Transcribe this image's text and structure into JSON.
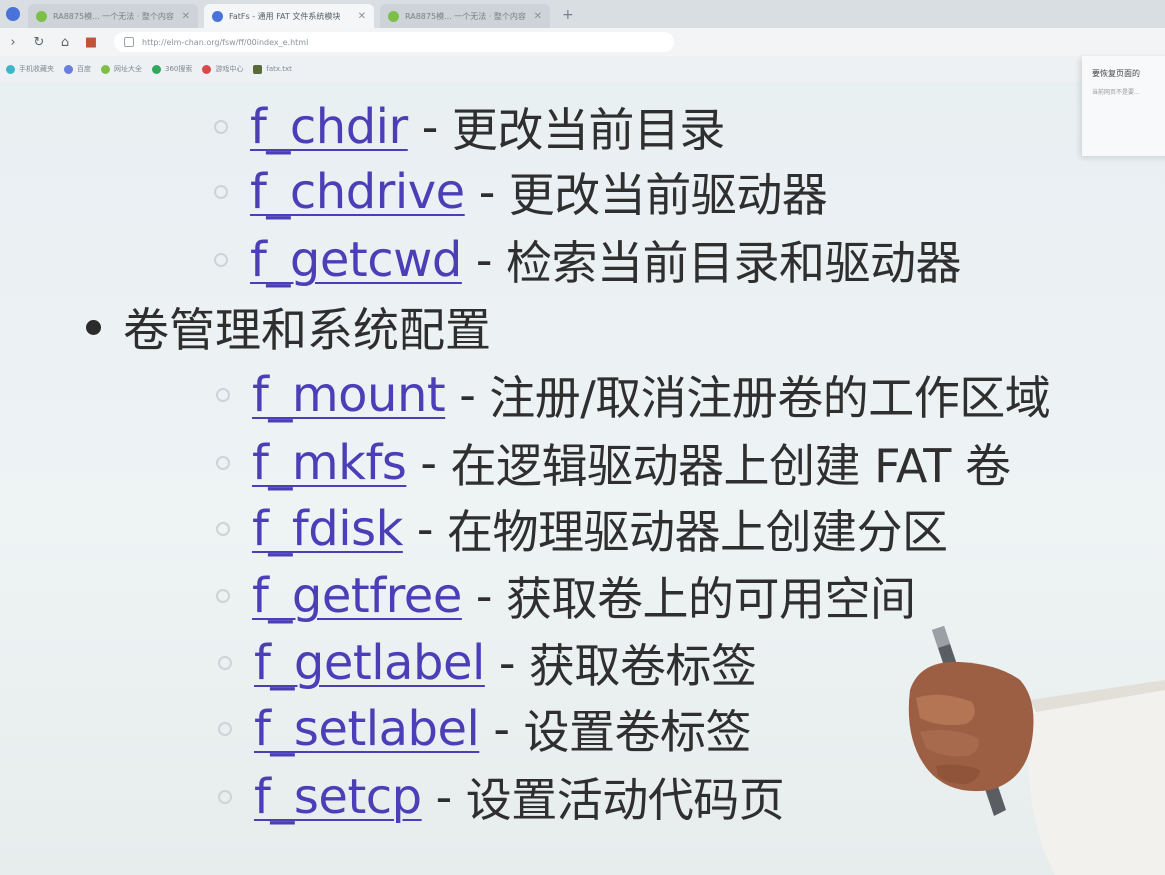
{
  "browser": {
    "tabs": [
      {
        "title": "RA8875模... 一个无法 · 整个内容",
        "active": false,
        "favicon_color": "#7cc04a"
      },
      {
        "title": "FatFs - 通用 FAT 文件系统模块",
        "active": true,
        "favicon_color": "#4a72d8"
      },
      {
        "title": "RA8875模... 一个无法 · 整个内容",
        "active": false,
        "favicon_color": "#7cc04a"
      }
    ],
    "address": "http://elm-chan.org/fsw/ff/00index_e.html",
    "bookmarks": [
      {
        "label": "手机收藏夹",
        "color": "#3fb6c8"
      },
      {
        "label": "百度",
        "color": "#6a7de0"
      },
      {
        "label": "网址大全",
        "color": "#7cc04a"
      },
      {
        "label": "360搜索",
        "color": "#32a85f"
      },
      {
        "label": "游戏中心",
        "color": "#d84a4a"
      },
      {
        "label": "fatx.txt",
        "color": "#5b6a3a"
      }
    ]
  },
  "notice": {
    "title": "要恢复页面的",
    "text": "当前网页不是要..."
  },
  "directory_items": [
    {
      "fn": "f_chdir",
      "desc": "更改当前目录"
    },
    {
      "fn": "f_chdrive",
      "desc": "更改当前驱动器"
    },
    {
      "fn": "f_getcwd",
      "desc": "检索当前目录和驱动器"
    }
  ],
  "volume_group": {
    "label": "卷管理和系统配置",
    "items": [
      {
        "fn": "f_mount",
        "desc": "注册/取消注册卷的工作区域"
      },
      {
        "fn": "f_mkfs",
        "desc": "在逻辑驱动器上创建 FAT 卷"
      },
      {
        "fn": "f_fdisk",
        "desc": "在物理驱动器上创建分区"
      },
      {
        "fn": "f_getfree",
        "desc": "获取卷上的可用空间"
      },
      {
        "fn": "f_getlabel",
        "desc": "获取卷标签"
      },
      {
        "fn": "f_setlabel",
        "desc": "设置卷标签"
      },
      {
        "fn": "f_setcp",
        "desc": "设置活动代码页"
      }
    ]
  },
  "separator": "-"
}
